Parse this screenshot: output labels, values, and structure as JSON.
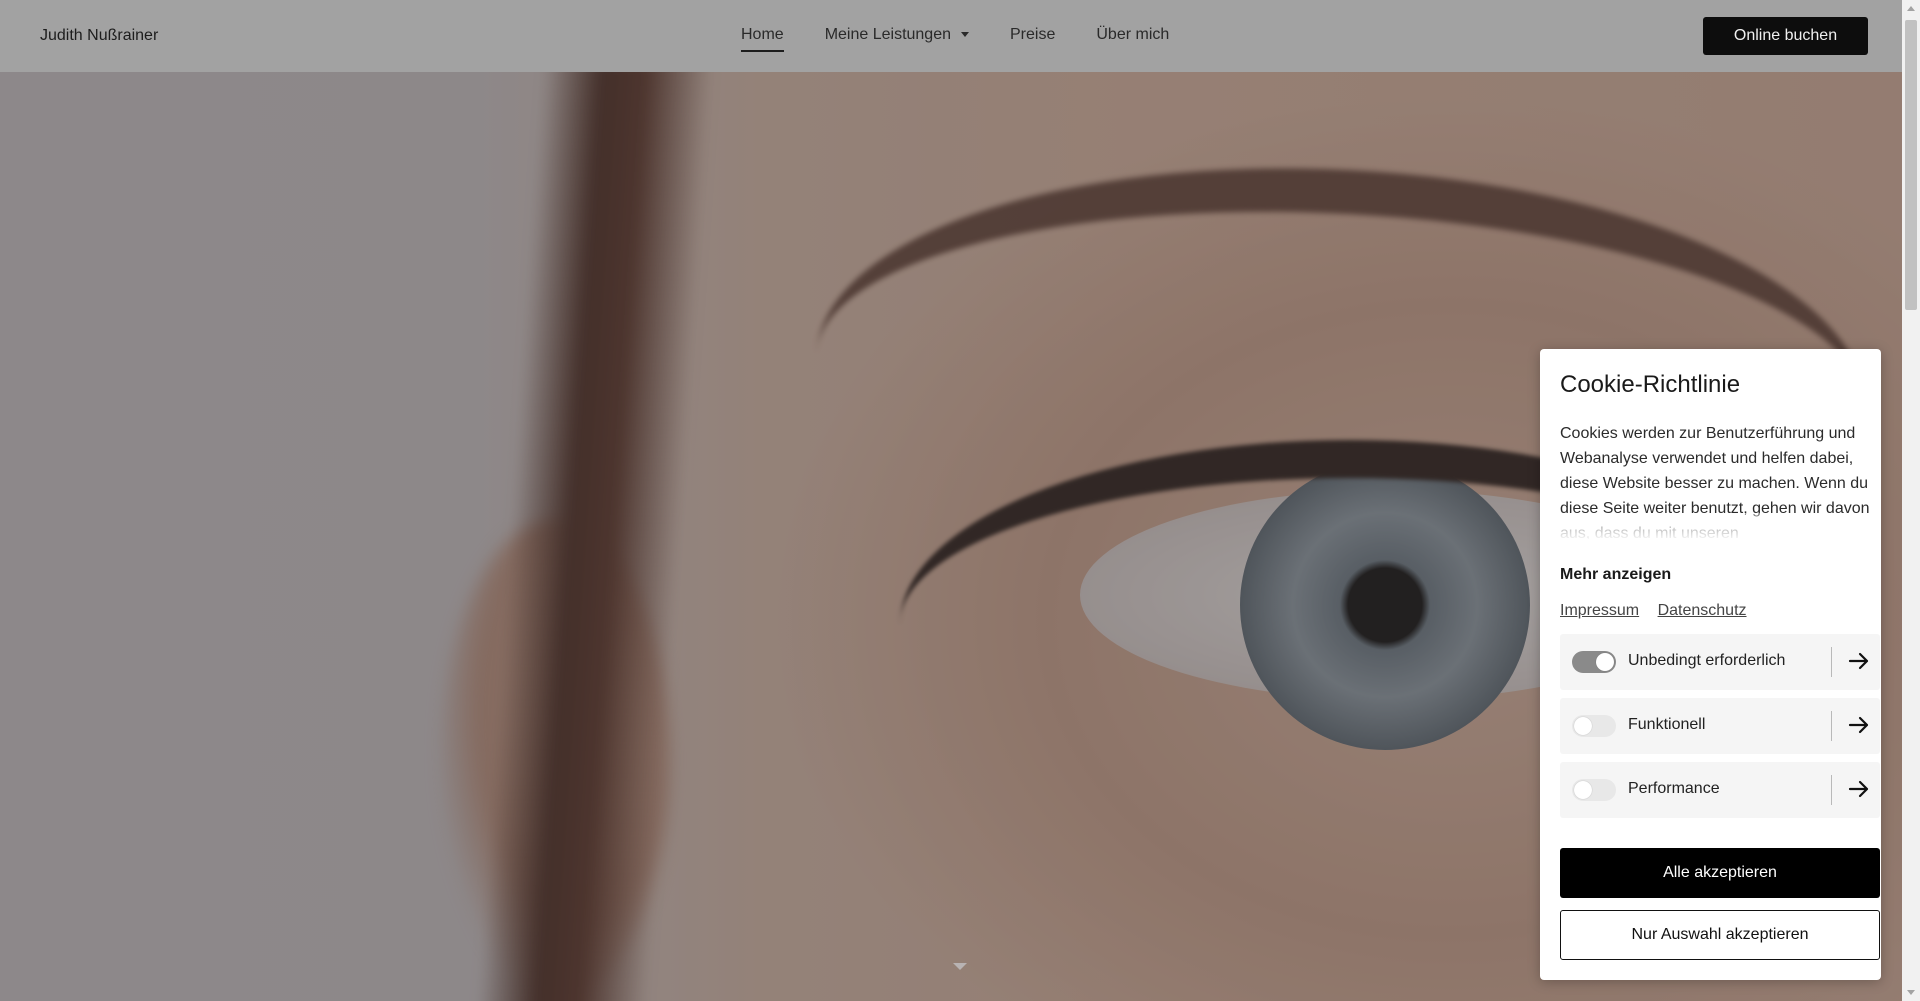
{
  "header": {
    "brand": "Judith Nußrainer",
    "nav": [
      {
        "label": "Home",
        "active": true
      },
      {
        "label": "Meine Leistungen",
        "has_dropdown": true
      },
      {
        "label": "Preise"
      },
      {
        "label": "Über mich"
      }
    ],
    "cta_label": "Online buchen"
  },
  "hero": {
    "image_icon": "eye-closeup-photo",
    "scroll_icon": "caret-down-icon"
  },
  "cookie": {
    "title": "Cookie-Richtlinie",
    "text": "Cookies werden zur Benutzerführung und Webanalyse verwendet und helfen dabei, diese Website besser zu machen. Wenn du diese Seite weiter benutzt, gehen wir davon aus, dass du mit unseren",
    "more_label": "Mehr anzeigen",
    "links": [
      "Impressum",
      "Datenschutz"
    ],
    "categories": [
      {
        "label": "Unbedingt erforderlich",
        "enabled": true
      },
      {
        "label": "Funktionell",
        "enabled": false
      },
      {
        "label": "Performance",
        "enabled": false
      }
    ],
    "accept_all_label": "Alle akzeptieren",
    "accept_selection_label": "Nur Auswahl akzeptieren"
  },
  "colors": {
    "header_bg": "#a2a2a2",
    "cta_bg": "#0d0d0d",
    "toggle_on": "#8a8a8a",
    "toggle_off": "#e8e8e8"
  }
}
